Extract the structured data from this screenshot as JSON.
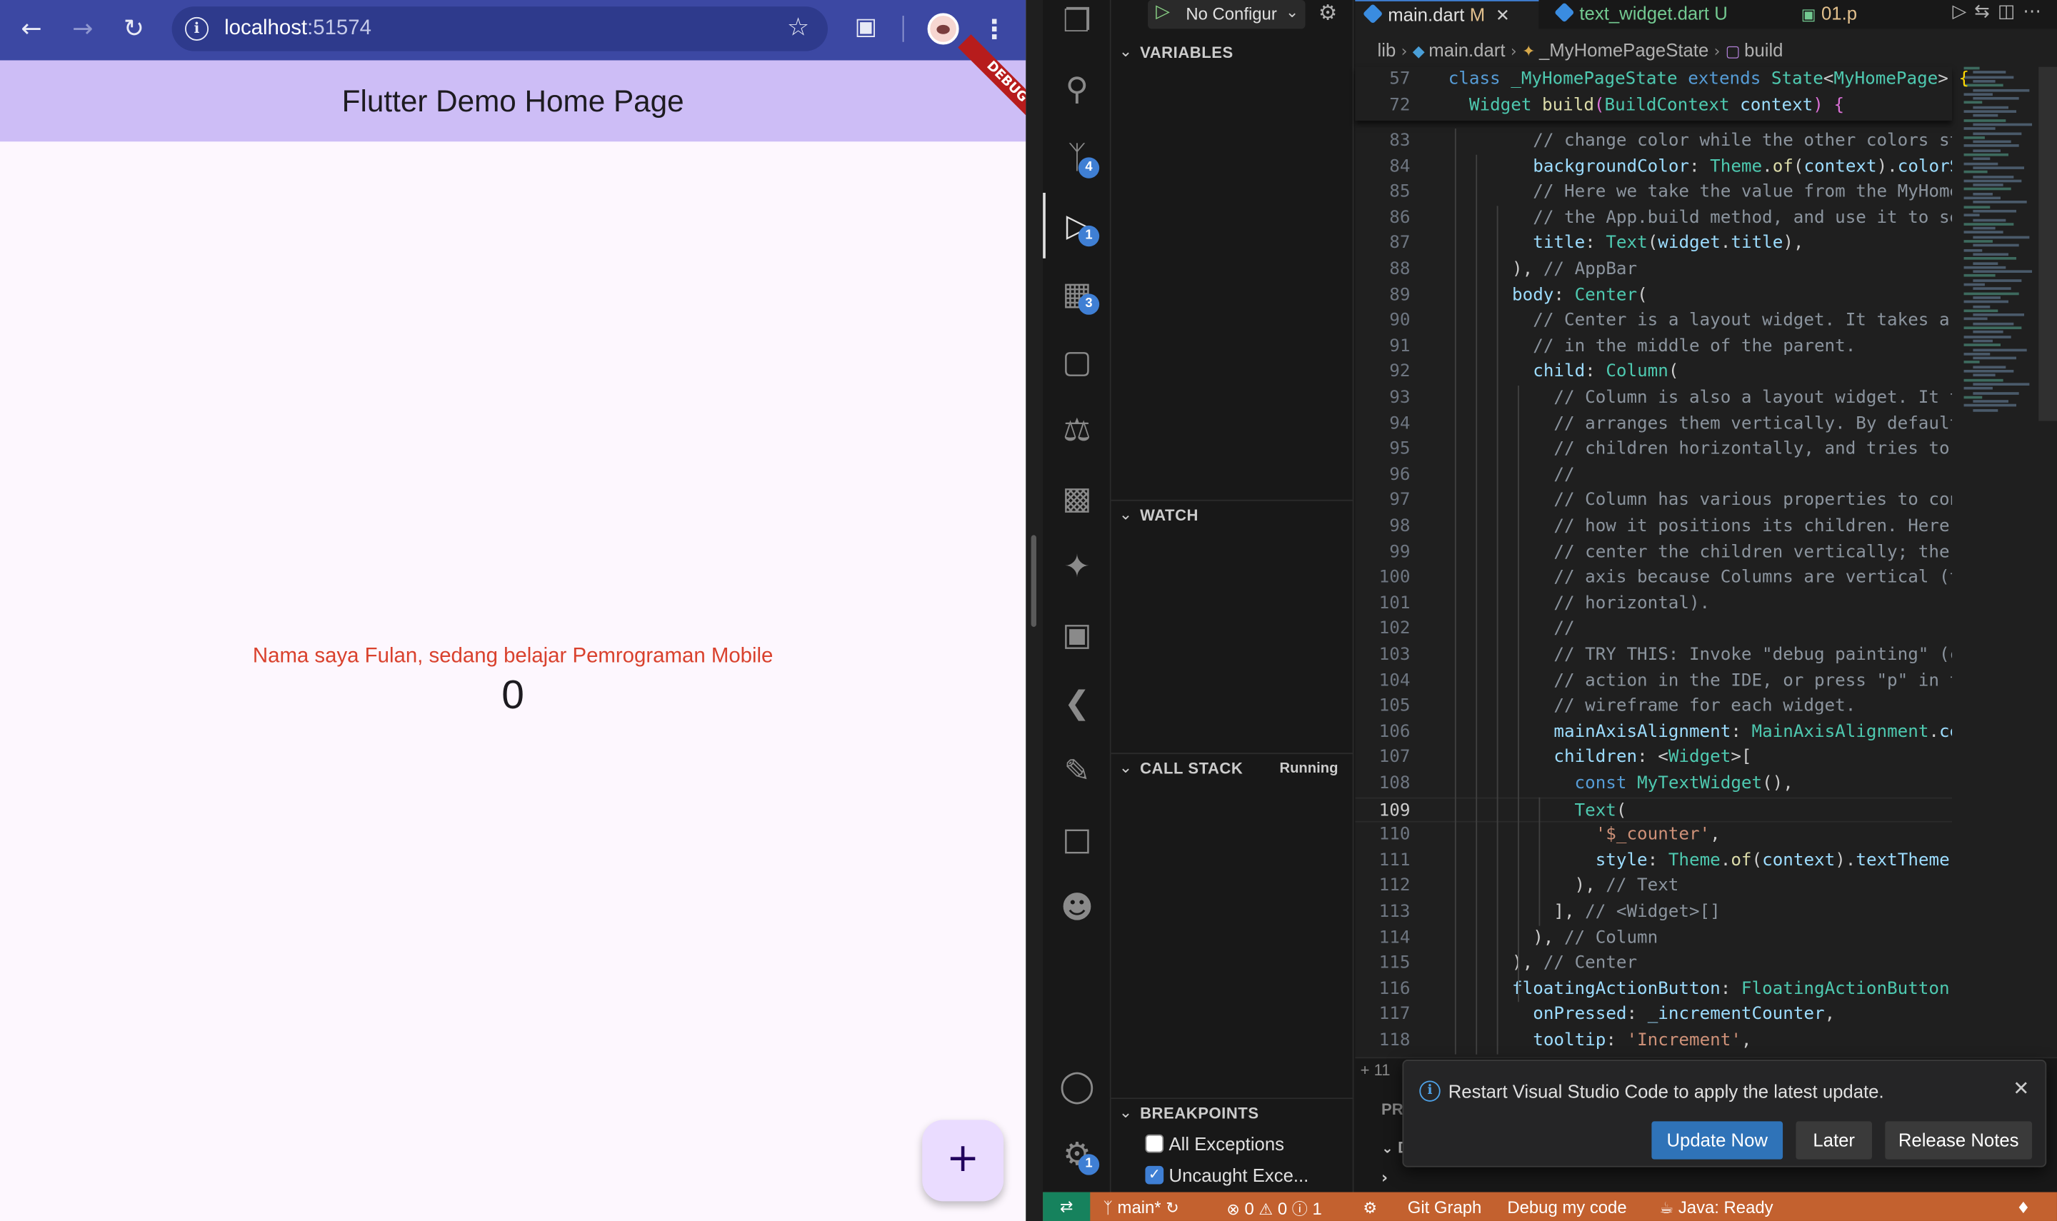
{
  "browser": {
    "url_host": "localhost",
    "url_port": ":51574",
    "back_icon": "arrow-left-icon",
    "forward_icon": "arrow-right-icon",
    "reload_icon": "reload-icon",
    "star_icon": "star-icon"
  },
  "flutter_app": {
    "app_bar_title": "Flutter Demo Home Page",
    "debug_banner": "DEBUG",
    "my_text": "Nama saya Fulan, sedang belajar Pemrograman Mobile",
    "counter": "0",
    "fab_label": "+",
    "colors": {
      "app_bar": "#cdbdf6",
      "text_red": "#d9412d",
      "fab": "#eadcff"
    }
  },
  "vscode": {
    "run_config_label": "No Configur",
    "activity_badges": {
      "source_control": "4",
      "run_debug": "1",
      "extensions": "3",
      "accounts_settings": "1"
    },
    "sections": {
      "variables": "VARIABLES",
      "watch": "WATCH",
      "call_stack": "CALL STACK",
      "call_stack_status": "Running",
      "breakpoints": "BREAKPOINTS"
    },
    "breakpoints": [
      {
        "label": "All Exceptions",
        "checked": false
      },
      {
        "label": "Uncaught Exce...",
        "checked": true
      }
    ],
    "tabs": [
      {
        "name": "main.dart",
        "status": "M",
        "active": true
      },
      {
        "name": "text_widget.dart",
        "status": "U",
        "active": false
      },
      {
        "name": "01.p",
        "status": "",
        "active": false
      }
    ],
    "breadcrumb": [
      "lib",
      "main.dart",
      "_MyHomePageState",
      "build"
    ],
    "sticky_lines": [
      {
        "num": "57",
        "text": "class _MyHomePageState extends State<MyHomePage> {"
      },
      {
        "num": "72",
        "text": "  Widget build(BuildContext context) {"
      }
    ],
    "code_lines": [
      {
        "num": "83",
        "text": "        // change color while the other colors st"
      },
      {
        "num": "84",
        "text": "        backgroundColor: Theme.of(context).colorS"
      },
      {
        "num": "85",
        "text": "        // Here we take the value from the MyHome"
      },
      {
        "num": "86",
        "text": "        // the App.build method, and use it to se"
      },
      {
        "num": "87",
        "text": "        title: Text(widget.title),"
      },
      {
        "num": "88",
        "text": "      ), // AppBar"
      },
      {
        "num": "89",
        "text": "      body: Center("
      },
      {
        "num": "90",
        "text": "        // Center is a layout widget. It takes a "
      },
      {
        "num": "91",
        "text": "        // in the middle of the parent."
      },
      {
        "num": "92",
        "text": "        child: Column("
      },
      {
        "num": "93",
        "text": "          // Column is also a layout widget. It t"
      },
      {
        "num": "94",
        "text": "          // arranges them vertically. By default"
      },
      {
        "num": "95",
        "text": "          // children horizontally, and tries to "
      },
      {
        "num": "96",
        "text": "          //"
      },
      {
        "num": "97",
        "text": "          // Column has various properties to con"
      },
      {
        "num": "98",
        "text": "          // how it positions its children. Here "
      },
      {
        "num": "99",
        "text": "          // center the children vertically; the "
      },
      {
        "num": "100",
        "text": "          // axis because Columns are vertical (t"
      },
      {
        "num": "101",
        "text": "          // horizontal)."
      },
      {
        "num": "102",
        "text": "          //"
      },
      {
        "num": "103",
        "text": "          // TRY THIS: Invoke \"debug painting\" (c"
      },
      {
        "num": "104",
        "text": "          // action in the IDE, or press \"p\" in t"
      },
      {
        "num": "105",
        "text": "          // wireframe for each widget."
      },
      {
        "num": "106",
        "text": "          mainAxisAlignment: MainAxisAlignment.ce"
      },
      {
        "num": "107",
        "text": "          children: <Widget>["
      },
      {
        "num": "108",
        "text": "            const MyTextWidget(),"
      },
      {
        "num": "109",
        "text": "            Text("
      },
      {
        "num": "110",
        "text": "              '$_counter',"
      },
      {
        "num": "111",
        "text": "              style: Theme.of(context).textTheme."
      },
      {
        "num": "112",
        "text": "            ), // Text"
      },
      {
        "num": "113",
        "text": "          ], // <Widget>[]"
      },
      {
        "num": "114",
        "text": "        ), // Column"
      },
      {
        "num": "115",
        "text": "      ), // Center"
      },
      {
        "num": "116",
        "text": "      floatingActionButton: FloatingActionButton("
      },
      {
        "num": "117",
        "text": "        onPressed: _incrementCounter,"
      },
      {
        "num": "118",
        "text": "        tooltip: 'Increment',"
      }
    ],
    "current_line": "109",
    "panel_partial": {
      "line_hint": "+ 11",
      "tab_hint": "PR",
      "section_hint": "DE"
    },
    "notification": {
      "message": "Restart Visual Studio Code to apply the latest update.",
      "primary": "Update Now",
      "secondary": "Later",
      "tertiary": "Release Notes"
    },
    "statusbar": {
      "branch": "main*",
      "errors": "0",
      "warnings": "0",
      "info": "1",
      "git_graph": "Git Graph",
      "debug_my_code": "Debug my code",
      "java": "Java: Ready"
    },
    "colors": {
      "statusbar": "#c3612f",
      "accent": "#3f7fd4"
    }
  }
}
